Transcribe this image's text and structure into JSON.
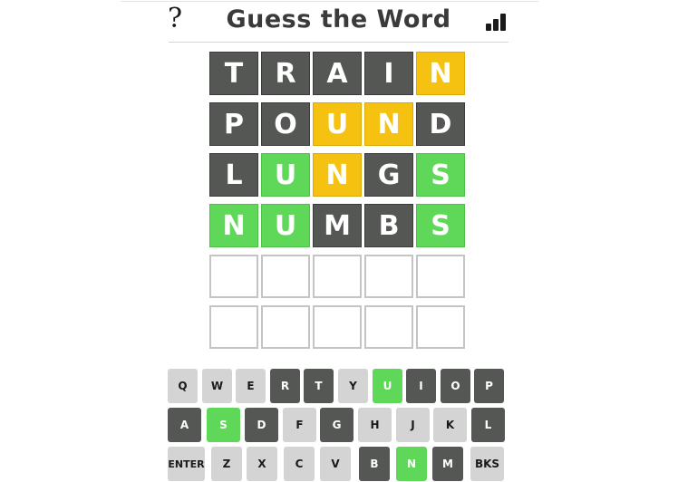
{
  "header": {
    "title": "Guess the Word",
    "help_glyph": "?"
  },
  "board": {
    "rows": [
      [
        {
          "letter": "T",
          "state": "absent"
        },
        {
          "letter": "R",
          "state": "absent"
        },
        {
          "letter": "A",
          "state": "absent"
        },
        {
          "letter": "I",
          "state": "absent"
        },
        {
          "letter": "N",
          "state": "present"
        }
      ],
      [
        {
          "letter": "P",
          "state": "absent"
        },
        {
          "letter": "O",
          "state": "absent"
        },
        {
          "letter": "U",
          "state": "present"
        },
        {
          "letter": "N",
          "state": "present"
        },
        {
          "letter": "D",
          "state": "absent"
        }
      ],
      [
        {
          "letter": "L",
          "state": "absent"
        },
        {
          "letter": "U",
          "state": "correct"
        },
        {
          "letter": "N",
          "state": "present"
        },
        {
          "letter": "G",
          "state": "absent"
        },
        {
          "letter": "S",
          "state": "correct"
        }
      ],
      [
        {
          "letter": "N",
          "state": "correct"
        },
        {
          "letter": "U",
          "state": "correct"
        },
        {
          "letter": "M",
          "state": "absent"
        },
        {
          "letter": "B",
          "state": "absent"
        },
        {
          "letter": "S",
          "state": "correct"
        }
      ],
      [
        {
          "letter": "",
          "state": "empty"
        },
        {
          "letter": "",
          "state": "empty"
        },
        {
          "letter": "",
          "state": "empty"
        },
        {
          "letter": "",
          "state": "empty"
        },
        {
          "letter": "",
          "state": "empty"
        }
      ],
      [
        {
          "letter": "",
          "state": "empty"
        },
        {
          "letter": "",
          "state": "empty"
        },
        {
          "letter": "",
          "state": "empty"
        },
        {
          "letter": "",
          "state": "empty"
        },
        {
          "letter": "",
          "state": "empty"
        }
      ]
    ]
  },
  "keyboard": {
    "rows": [
      [
        {
          "label": "Q",
          "state": "unused"
        },
        {
          "label": "W",
          "state": "unused"
        },
        {
          "label": "E",
          "state": "unused"
        },
        {
          "label": "R",
          "state": "absent"
        },
        {
          "label": "T",
          "state": "absent"
        },
        {
          "label": "Y",
          "state": "unused"
        },
        {
          "label": "U",
          "state": "correct"
        },
        {
          "label": "I",
          "state": "absent"
        },
        {
          "label": "O",
          "state": "absent"
        },
        {
          "label": "P",
          "state": "absent"
        }
      ],
      [
        {
          "label": "A",
          "state": "absent"
        },
        {
          "label": "S",
          "state": "correct"
        },
        {
          "label": "D",
          "state": "absent"
        },
        {
          "label": "F",
          "state": "unused"
        },
        {
          "label": "G",
          "state": "absent"
        },
        {
          "label": "H",
          "state": "unused"
        },
        {
          "label": "J",
          "state": "unused"
        },
        {
          "label": "K",
          "state": "unused"
        },
        {
          "label": "L",
          "state": "absent"
        }
      ],
      [
        {
          "label": "ENTER",
          "state": "unused"
        },
        {
          "label": "Z",
          "state": "unused"
        },
        {
          "label": "X",
          "state": "unused"
        },
        {
          "label": "C",
          "state": "unused"
        },
        {
          "label": "V",
          "state": "unused"
        },
        {
          "label": "B",
          "state": "absent"
        },
        {
          "label": "N",
          "state": "correct"
        },
        {
          "label": "M",
          "state": "absent"
        },
        {
          "label": "BKS",
          "state": "unused"
        }
      ]
    ]
  },
  "colors": {
    "absent": "#555755",
    "present": "#f5c211",
    "correct": "#5fd85a",
    "unused_key": "#d4d4d4",
    "empty_border": "#c4c4c4"
  },
  "icons": {
    "help": "help-icon",
    "stats": "stats-icon"
  }
}
